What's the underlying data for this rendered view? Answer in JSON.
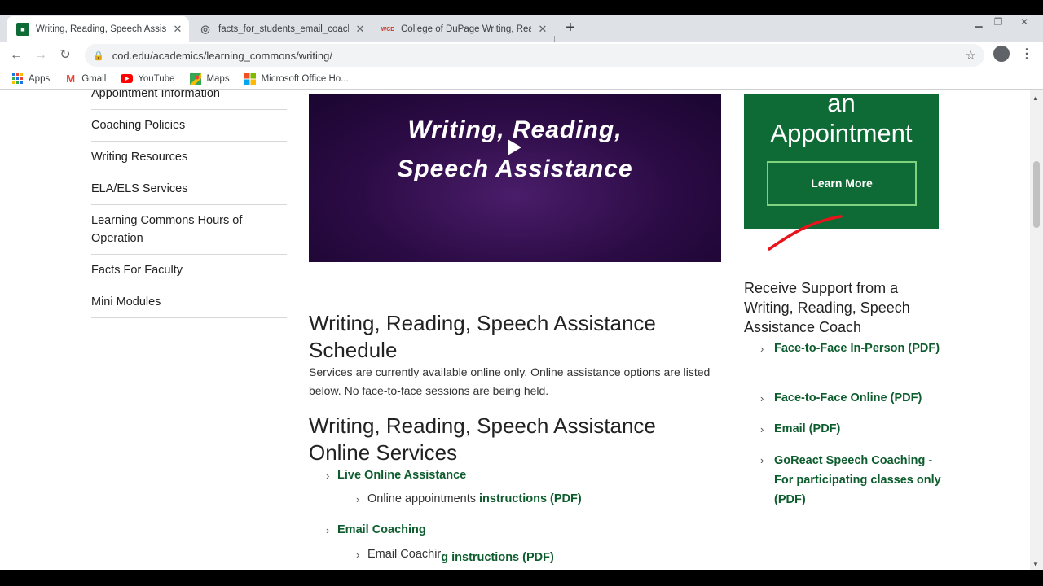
{
  "tabs": [
    {
      "title": "Writing, Reading, Speech Assista",
      "favicon": "cod-icon",
      "active": true
    },
    {
      "title": "facts_for_students_email_coachin",
      "favicon": "globe-icon",
      "active": false
    },
    {
      "title": "College of DuPage Writing, Read",
      "favicon": "wcd-icon",
      "active": false
    }
  ],
  "favicon_text": {
    "wcd": "WCD"
  },
  "address_bar": {
    "url": "cod.edu/academics/learning_commons/writing/"
  },
  "bookmarks": [
    {
      "label": "Apps",
      "icon": "apps-grid-icon"
    },
    {
      "label": "Gmail",
      "icon": "gmail-icon"
    },
    {
      "label": "YouTube",
      "icon": "youtube-icon"
    },
    {
      "label": "Maps",
      "icon": "maps-icon"
    },
    {
      "label": "Microsoft Office Ho...",
      "icon": "office-icon"
    }
  ],
  "sidebar": {
    "partial_item": "Appointment Information",
    "items": [
      "Coaching Policies",
      "Writing Resources",
      "ELA/ELS Services",
      "Learning Commons Hours of Operation",
      "Facts For Faculty",
      "Mini Modules"
    ]
  },
  "video": {
    "line1": "Writing, Reading,",
    "line2": "Speech Assistance"
  },
  "appointment_promo": {
    "line1": "an",
    "line2": "Appointment",
    "button": "Learn More"
  },
  "main": {
    "schedule_heading": "Writing, Reading, Speech Assistance Schedule",
    "schedule_text": "Services are currently available online only. Online assistance options are listed below. No face-to-face sessions are being held.",
    "online_heading": "Writing, Reading, Speech Assistance Online Services",
    "live_online": "Live Online Assistance",
    "online_appts_prefix": "Online appointments",
    "online_appts_link": "instructions (PDF)",
    "email_coaching": "Email Coaching",
    "email_coaching_prefix": "Email Coachir",
    "email_coaching_link": "g instructions (PDF)"
  },
  "support": {
    "heading": "Receive Support from a Writing, Reading, Speech Assistance Coach",
    "links": [
      "Face-to-Face In-Person (PDF)",
      "Face-to-Face Online (PDF)",
      "Email (PDF)",
      "GoReact Speech Coaching - For participating classes only (PDF)"
    ]
  },
  "colors": {
    "accent_green": "#0e6b35",
    "link_green": "#0d5c2e",
    "video_purple": "#2b0b44",
    "annotation_red": "#e8141c"
  }
}
